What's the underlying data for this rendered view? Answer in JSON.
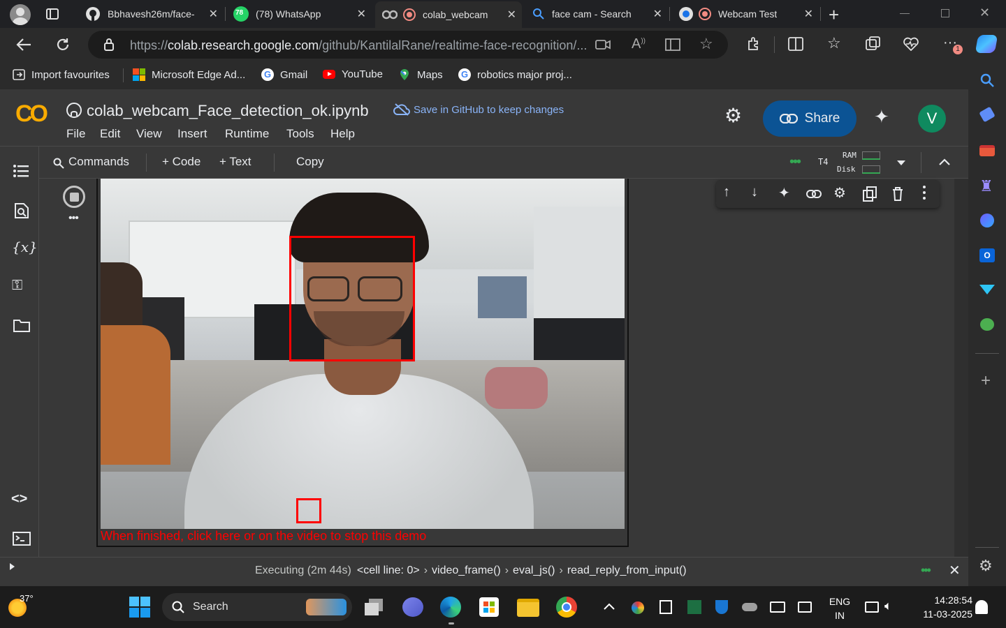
{
  "tabs": [
    {
      "label": "Bbhavesh26m/face-",
      "icon": "github-icon"
    },
    {
      "label": "(78) WhatsApp",
      "icon": "whatsapp-icon",
      "badge": "78"
    },
    {
      "label": "colab_webcam",
      "icon": "colab-icon"
    },
    {
      "label": "face cam - Search",
      "icon": "search-icon"
    },
    {
      "label": "Webcam Test",
      "icon": "webcam-icon"
    }
  ],
  "url": {
    "prefix": "https://",
    "domain": "colab.research.google.com",
    "path": "/github/KantilalRane/realtime-face-recognition/..."
  },
  "bookmarks": [
    {
      "label": "Import favourites"
    },
    {
      "label": "Microsoft Edge Ad..."
    },
    {
      "label": "Gmail"
    },
    {
      "label": "YouTube"
    },
    {
      "label": "Maps"
    },
    {
      "label": "robotics major proj..."
    }
  ],
  "colab": {
    "logo": "CO",
    "title": "colab_webcam_Face_detection_ok.ipynb",
    "save_link": "Save in GitHub to keep changes",
    "share_label": "Share",
    "avatar": "V",
    "menu": [
      "File",
      "Edit",
      "View",
      "Insert",
      "Runtime",
      "Tools",
      "Help"
    ]
  },
  "toolbar": {
    "commands": "Commands",
    "code": "+ Code",
    "text": "+ Text",
    "copy": "Copy",
    "runtime_type": "T4",
    "ram_label": "RAM",
    "disk_label": "Disk"
  },
  "output": {
    "stop_text": "When finished, click here or on the video to stop this demo"
  },
  "status": {
    "executing": "Executing (2m 44s)",
    "trace": [
      "<cell line: 0>",
      "video_frame()",
      "eval_js()",
      "read_reply_from_input()"
    ]
  },
  "taskbar": {
    "weather": "37°",
    "search": "Search",
    "lang1": "ENG",
    "lang2": "IN",
    "time": "14:28:54",
    "date": "11-03-2025"
  },
  "notification_badge": "1"
}
